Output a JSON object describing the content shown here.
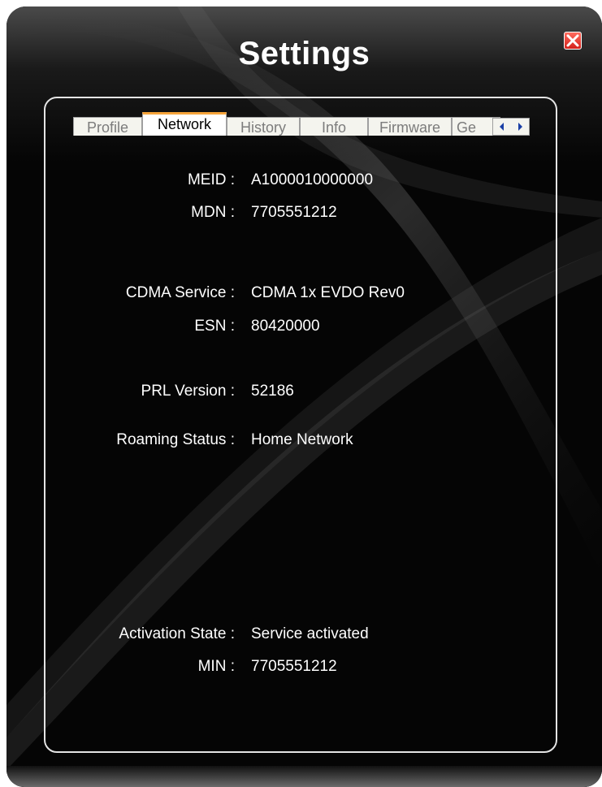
{
  "window": {
    "title": "Settings",
    "close_icon": "close-x-icon",
    "close_color": "#e0291f"
  },
  "tabs": [
    {
      "label": "Profile",
      "active": false
    },
    {
      "label": "Network",
      "active": true
    },
    {
      "label": "History",
      "active": false
    },
    {
      "label": "Info",
      "active": false
    },
    {
      "label": "Firmware",
      "active": false
    },
    {
      "label": "Ge",
      "active": false
    }
  ],
  "tab_scroll": {
    "left_icon": "arrow-left-icon",
    "right_icon": "arrow-right-icon"
  },
  "accent_color": "#f6a43a",
  "fields": {
    "meid": {
      "label": "MEID :",
      "value": "A1000010000000"
    },
    "mdn": {
      "label": "MDN :",
      "value": "7705551212"
    },
    "cdma_service": {
      "label": "CDMA Service :",
      "value": "CDMA 1x EVDO Rev0"
    },
    "esn": {
      "label": "ESN :",
      "value": "80420000"
    },
    "prl_version": {
      "label": "PRL Version :",
      "value": "52186"
    },
    "roaming_status": {
      "label": "Roaming Status :",
      "value": "Home Network"
    },
    "activation_state": {
      "label": "Activation State :",
      "value": "Service activated"
    },
    "min": {
      "label": "MIN :",
      "value": "7705551212"
    }
  }
}
